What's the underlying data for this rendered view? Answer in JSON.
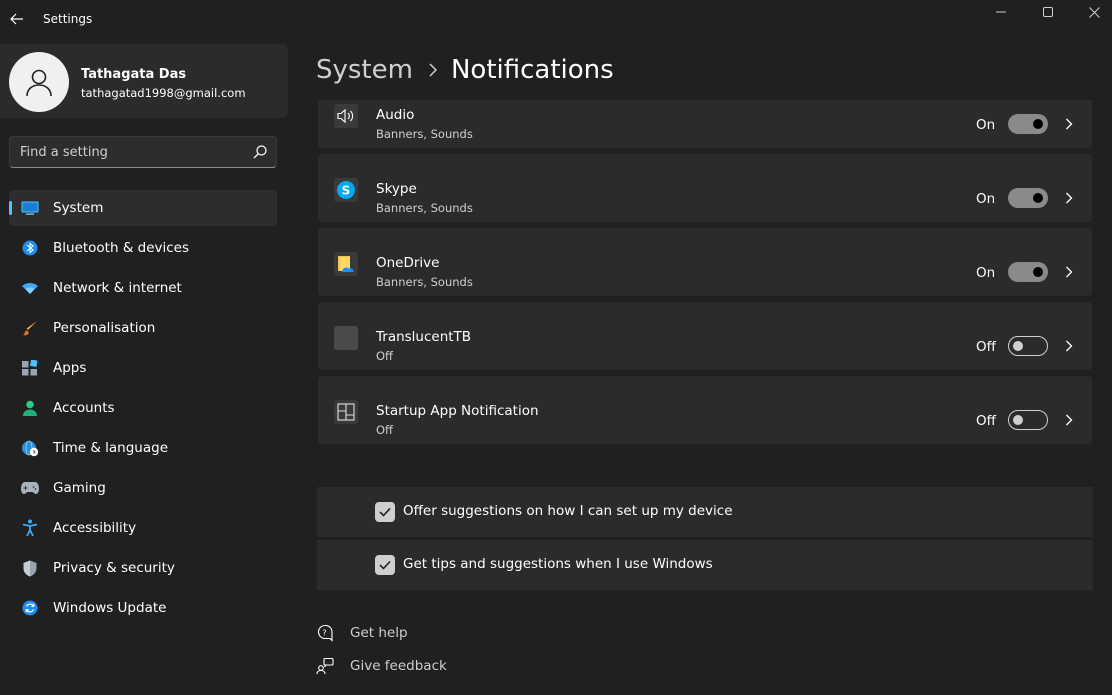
{
  "window": {
    "title": "Settings"
  },
  "profile": {
    "name": "Tathagata Das",
    "email": "tathagatad1998@gmail.com"
  },
  "search": {
    "placeholder": "Find a setting"
  },
  "sidebar": {
    "items": [
      {
        "label": "System",
        "icon": "monitor-icon",
        "active": true
      },
      {
        "label": "Bluetooth & devices",
        "icon": "bluetooth-icon"
      },
      {
        "label": "Network & internet",
        "icon": "wifi-icon"
      },
      {
        "label": "Personalisation",
        "icon": "brush-icon"
      },
      {
        "label": "Apps",
        "icon": "apps-icon"
      },
      {
        "label": "Accounts",
        "icon": "person-icon"
      },
      {
        "label": "Time & language",
        "icon": "globe-clock-icon"
      },
      {
        "label": "Gaming",
        "icon": "gamepad-icon"
      },
      {
        "label": "Accessibility",
        "icon": "accessibility-icon"
      },
      {
        "label": "Privacy & security",
        "icon": "shield-icon"
      },
      {
        "label": "Windows Update",
        "icon": "update-icon"
      }
    ]
  },
  "breadcrumb": {
    "parent": "System",
    "current": "Notifications"
  },
  "apps": [
    {
      "name": "Audio",
      "sub": "Banners, Sounds",
      "state": "On",
      "on": true,
      "icon": "speaker-icon"
    },
    {
      "name": "Skype",
      "sub": "Banners, Sounds",
      "state": "On",
      "on": true,
      "icon": "skype-icon"
    },
    {
      "name": "OneDrive",
      "sub": "Banners, Sounds",
      "state": "On",
      "on": true,
      "icon": "onedrive-icon"
    },
    {
      "name": "TranslucentTB",
      "sub": "Off",
      "state": "Off",
      "on": false,
      "icon": "translucenttb-icon"
    },
    {
      "name": "Startup App Notification",
      "sub": "Off",
      "state": "Off",
      "on": false,
      "icon": "startup-app-icon"
    }
  ],
  "checkboxes": [
    {
      "label": "Offer suggestions on how I can set up my device",
      "checked": true
    },
    {
      "label": "Get tips and suggestions when I use Windows",
      "checked": true
    }
  ],
  "links": {
    "help": "Get help",
    "feedback": "Give feedback"
  },
  "colors": {
    "background": "#202020",
    "card": "#2b2b2b",
    "accent": "#4cc2ff"
  }
}
